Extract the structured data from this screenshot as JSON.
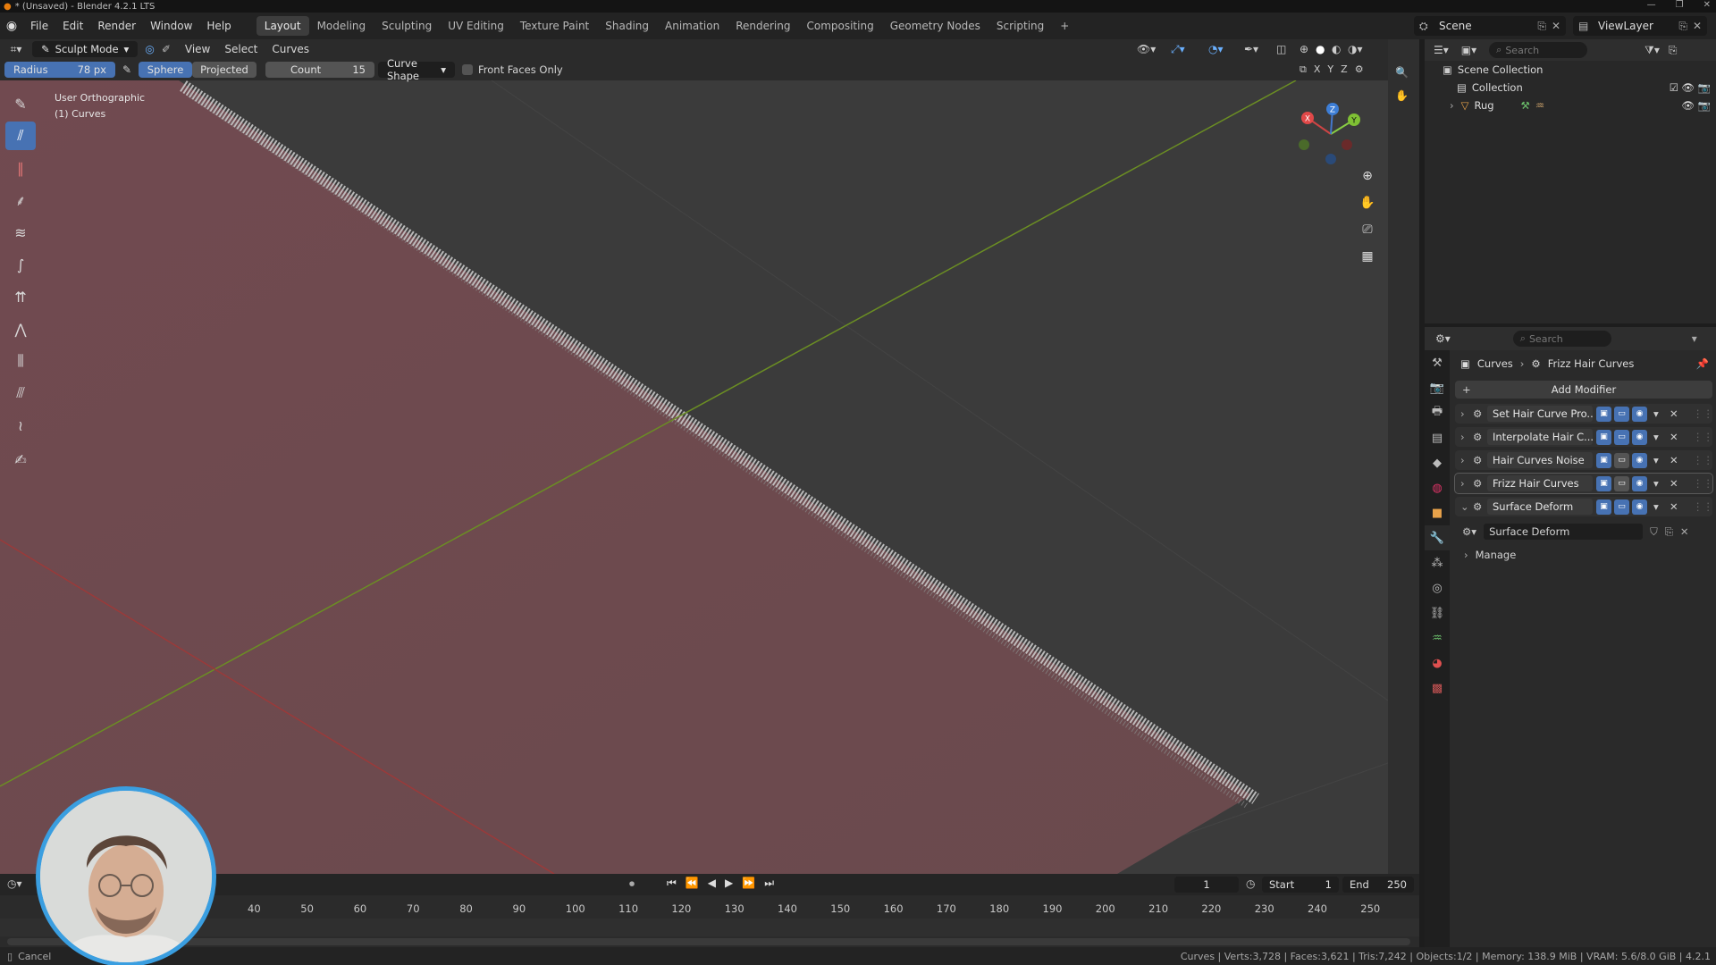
{
  "titlebar": {
    "title": "* (Unsaved) - Blender 4.2.1 LTS"
  },
  "menu": [
    "File",
    "Edit",
    "Render",
    "Window",
    "Help"
  ],
  "workspaces": {
    "active": "Layout",
    "tabs": [
      "Layout",
      "Modeling",
      "Sculpting",
      "UV Editing",
      "Texture Paint",
      "Shading",
      "Animation",
      "Rendering",
      "Compositing",
      "Geometry Nodes",
      "Scripting"
    ],
    "add": "+"
  },
  "scene": {
    "name": "Scene",
    "view_layer": "ViewLayer"
  },
  "viewport": {
    "mode": "Sculpt Mode",
    "menus": [
      "View",
      "Select",
      "Curves"
    ],
    "tool_settings": {
      "radius_label": "Radius",
      "radius_value": "78 px",
      "falloff_sphere": "Sphere",
      "falloff_projected": "Projected",
      "count_label": "Count",
      "count_value": "15",
      "curve_shape": "Curve Shape",
      "front_faces_only": "Front Faces Only"
    },
    "axis_locks": [
      "X",
      "Y",
      "Z"
    ],
    "view_name": "User Orthographic",
    "object_info": "(1) Curves",
    "gizmo": {
      "x": "X",
      "y": "Y",
      "z": "Z"
    },
    "accent_color": "#4772b3",
    "surface_color": "#6e4b4f"
  },
  "timeline": {
    "current_frame": "1",
    "start_label": "Start",
    "start_value": "1",
    "end_label": "End",
    "end_value": "250",
    "ruler": [
      "40",
      "50",
      "60",
      "70",
      "80",
      "90",
      "100",
      "110",
      "120",
      "130",
      "140",
      "150",
      "160",
      "170",
      "180",
      "190",
      "200",
      "210",
      "220",
      "230",
      "240",
      "250"
    ]
  },
  "statusbar": {
    "cancel": "Cancel",
    "stats": "Curves | Verts:3,728 | Faces:3,621 | Tris:7,242 | Objects:1/2 | Memory: 138.9 MiB | VRAM: 5.6/8.0 GiB | 4.2.1"
  },
  "outliner": {
    "search_placeholder": "Search",
    "scene_collection": "Scene Collection",
    "collection": "Collection",
    "object": "Rug"
  },
  "properties": {
    "search_placeholder": "Search",
    "breadcrumb_object": "Curves",
    "breadcrumb_modifier": "Frizz Hair Curves",
    "add_modifier": "Add Modifier",
    "modifiers": [
      {
        "name": "Set Hair Curve Pro...",
        "viewport_on": true
      },
      {
        "name": "Interpolate Hair C...",
        "viewport_on": true
      },
      {
        "name": "Hair Curves Noise",
        "viewport_on": false
      },
      {
        "name": "Frizz Hair Curves",
        "viewport_on": false
      },
      {
        "name": "Surface Deform",
        "viewport_on": true
      }
    ],
    "node_group": "Surface Deform",
    "manage": "Manage"
  }
}
